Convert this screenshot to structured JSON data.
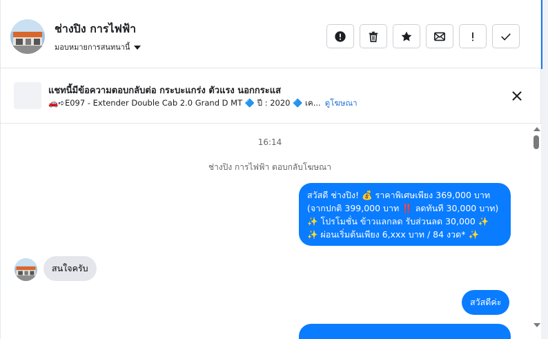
{
  "header": {
    "contact_name": "ช่างปิง การไฟฟ้า",
    "assign_label": "มอบหมายการสนทนานี้",
    "actions": [
      {
        "name": "spam-button",
        "icon": "alert-circle-icon"
      },
      {
        "name": "delete-button",
        "icon": "trash-icon"
      },
      {
        "name": "star-button",
        "icon": "star-icon"
      },
      {
        "name": "mark-unread-button",
        "icon": "envelope-icon"
      },
      {
        "name": "follow-up-button",
        "icon": "exclamation-icon"
      },
      {
        "name": "mark-done-button",
        "icon": "check-icon"
      }
    ]
  },
  "banner": {
    "title": "แชทนี้มีข้อความตอบกลับต่อ กระบะแกร่ง ตัวแรง นอกกระแส",
    "subtitle": "🚗➪E097 - Extender Double Cab 2.0 Grand D MT 🔷 ปี : 2020 🔷 เค...",
    "link": "ดูโฆษณา"
  },
  "chat": {
    "time": "16:14",
    "system_note": "ช่างปิง การไฟฟ้า ตอบกลับโฆษณา",
    "messages": {
      "m1": {
        "line1": "สวัสดี ช่างปิง! 💰 ราคาพิเศษเพียง 369,000 บาท",
        "line2": "(จากปกติ 399,000 บาท ‼️ ลดทันที 30,000 บาท)",
        "line3": "✨ โปรโมชั่น ข้าวแลกลด รับส่วนลด 30,000 ✨",
        "line4": "✨ ผ่อนเริ่มต้นเพียง 6,xxx บาท / 84 งวด* ✨"
      },
      "m2": "สนใจครับ",
      "m3": "สวัสดีค่ะ"
    }
  },
  "colors": {
    "accent": "#1877f2",
    "outgoing_bubble": "#0a7cff",
    "incoming_bubble": "#e4e6eb",
    "link": "#216fdb"
  }
}
